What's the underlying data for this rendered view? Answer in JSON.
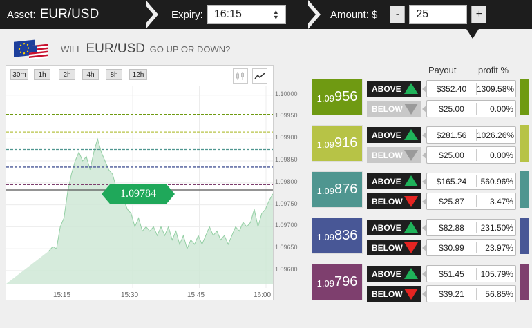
{
  "topbar": {
    "asset_label": "Asset:",
    "asset_value": "EUR/USD",
    "expiry_label": "Expiry:",
    "expiry_value": "16:15",
    "amount_label": "Amount: $",
    "amount_minus": "-",
    "amount_value": "25",
    "amount_plus": "+"
  },
  "question": {
    "prefix": "WILL",
    "pair": "EUR/USD",
    "suffix": "GO UP OR DOWN?"
  },
  "chart": {
    "timeframes": [
      "30m",
      "1h",
      "2h",
      "4h",
      "8h",
      "12h"
    ],
    "chart_type_icons": [
      "candlestick-icon",
      "line-chart-icon"
    ],
    "current_price": "1.09784",
    "strike_line_colors": [
      "#6f9a12",
      "#b7c346",
      "#4f9690",
      "#485796",
      "#7e3f6e"
    ],
    "area_color": "#cfe8d6",
    "area_line_color": "#94cfa4"
  },
  "chart_data": {
    "type": "area",
    "xlabel": "",
    "ylabel": "",
    "x_ticks": [
      "15:15",
      "15:30",
      "15:45",
      "16:00"
    ],
    "y_ticks": [
      "1.10000",
      "1.09950",
      "1.09900",
      "1.09850",
      "1.09800",
      "1.09750",
      "1.09700",
      "1.09650",
      "1.09600"
    ],
    "ylim": [
      1.0957,
      1.1002
    ],
    "grid": true,
    "strike_levels": [
      1.09956,
      1.09916,
      1.09876,
      1.09836,
      1.09796
    ],
    "current_level": 1.09784,
    "x_minutes": [
      0,
      1,
      2,
      3,
      4,
      5,
      6,
      7,
      8,
      9,
      10,
      11,
      12,
      13,
      14,
      15,
      16,
      17,
      18,
      19,
      20,
      21,
      22,
      23,
      24,
      25,
      26,
      27,
      28,
      29,
      30,
      31,
      32,
      33,
      34,
      35,
      36,
      37,
      38,
      39,
      40,
      41,
      42,
      43,
      44,
      45,
      46,
      47,
      48,
      49,
      50,
      51,
      52,
      53,
      54,
      55,
      56,
      57,
      58,
      59,
      60
    ],
    "series": [
      {
        "values": [
          1.09645,
          1.09655,
          1.0965,
          1.097,
          1.0972,
          1.0978,
          1.0982,
          1.0985,
          1.0987,
          1.0985,
          1.0986,
          1.0983,
          1.0987,
          1.099,
          1.0987,
          1.0985,
          1.0983,
          1.0982,
          1.0979,
          1.0977,
          1.0976,
          1.0974,
          1.0973,
          1.097,
          1.0972,
          1.0969,
          1.097,
          1.0969,
          1.097,
          1.0968,
          1.097,
          1.0968,
          1.097,
          1.0967,
          1.0969,
          1.0966,
          1.0968,
          1.0965,
          1.0967,
          1.0966,
          1.0968,
          1.0966,
          1.0968,
          1.097,
          1.0968,
          1.0969,
          1.0967,
          1.0968,
          1.0966,
          1.0968,
          1.097,
          1.0969,
          1.0971,
          1.097,
          1.0971,
          1.0974,
          1.097,
          1.0973,
          1.0974,
          1.0976,
          1.09775
        ]
      }
    ]
  },
  "table": {
    "payout_header": "Payout",
    "profit_header": "profit %",
    "rows": [
      {
        "strike_prefix": "1.09",
        "strike_main": "956",
        "color": "#6f9a12",
        "strip_color": "#6f9a12",
        "above": {
          "label": "ABOVE",
          "active": true,
          "payout": "$352.40",
          "profit": "1309.58%"
        },
        "below": {
          "label": "BELOW",
          "active": false,
          "payout": "$25.00",
          "profit": "0.00%"
        }
      },
      {
        "strike_prefix": "1.09",
        "strike_main": "916",
        "color": "#b7c346",
        "strip_color": "#b7c346",
        "above": {
          "label": "ABOVE",
          "active": true,
          "payout": "$281.56",
          "profit": "1026.26%"
        },
        "below": {
          "label": "BELOW",
          "active": false,
          "payout": "$25.00",
          "profit": "0.00%"
        }
      },
      {
        "strike_prefix": "1.09",
        "strike_main": "876",
        "color": "#4f9690",
        "strip_color": "#4f9690",
        "above": {
          "label": "ABOVE",
          "active": true,
          "payout": "$165.24",
          "profit": "560.96%"
        },
        "below": {
          "label": "BELOW",
          "active": true,
          "payout": "$25.87",
          "profit": "3.47%"
        }
      },
      {
        "strike_prefix": "1.09",
        "strike_main": "836",
        "color": "#485796",
        "strip_color": "#485796",
        "above": {
          "label": "ABOVE",
          "active": true,
          "payout": "$82.88",
          "profit": "231.50%"
        },
        "below": {
          "label": "BELOW",
          "active": true,
          "payout": "$30.99",
          "profit": "23.97%"
        }
      },
      {
        "strike_prefix": "1.09",
        "strike_main": "796",
        "color": "#7e3f6e",
        "strip_color": "#7e3f6e",
        "above": {
          "label": "ABOVE",
          "active": true,
          "payout": "$51.45",
          "profit": "105.79%"
        },
        "below": {
          "label": "BELOW",
          "active": true,
          "payout": "$39.21",
          "profit": "56.85%"
        }
      }
    ]
  }
}
